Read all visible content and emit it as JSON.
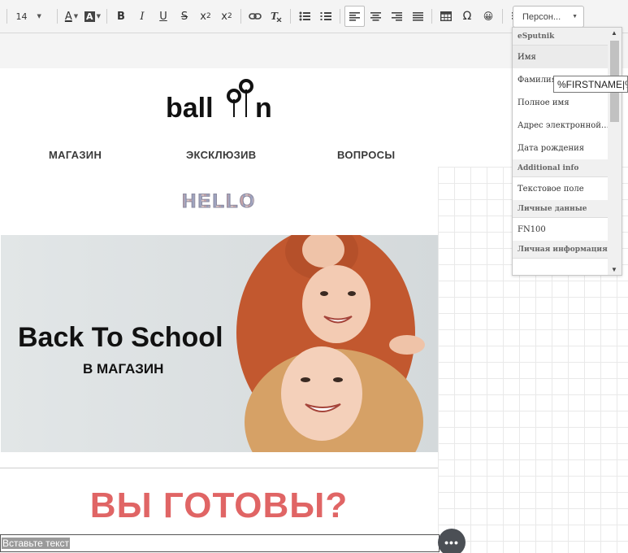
{
  "toolbar": {
    "font_size": "14",
    "persona_label": "Персон...",
    "icons": [
      "font-color-icon",
      "highlight-color-icon",
      "bold-icon",
      "italic-icon",
      "underline-icon",
      "strikethrough-icon",
      "subscript-icon",
      "superscript-icon",
      "link-icon",
      "clear-format-icon",
      "bulleted-list-icon",
      "numbered-list-icon",
      "align-left-icon",
      "align-center-icon",
      "align-right-icon",
      "align-justify-icon",
      "table-icon",
      "special-char-icon",
      "emoji-icon",
      "insert-field-icon"
    ]
  },
  "glyphs": {
    "font_color": "A",
    "highlight": "A",
    "bold": "B",
    "italic": "I",
    "underline": "U",
    "strike": "S",
    "sub_base": "x",
    "sub_idx": "2",
    "sup_base": "x",
    "sup_idx": "2",
    "omega": "Ω",
    "emoji": "😀"
  },
  "email": {
    "logo": "balloon",
    "nav": [
      "МАГАЗИН",
      "ЭКСКЛЮЗИВ",
      "ВОПРОСЫ"
    ],
    "hello": "HELLO",
    "hero_title": "Back To School",
    "hero_subtitle": "В МАГАЗИН",
    "ready": "ВЫ ГОТОВЫ?"
  },
  "insert_bar": {
    "text": "Вставьте текст",
    "more": "•••"
  },
  "dropdown": {
    "groups": [
      {
        "title": "eSputnik",
        "items": [
          "Имя",
          "Фамилия",
          "Полное имя",
          "Адрес электронной почты",
          "Дата рождения"
        ]
      },
      {
        "title": "Additional info",
        "items": [
          "Текстовое поле"
        ]
      },
      {
        "title": "Личные данные",
        "items": [
          "FN100"
        ]
      },
      {
        "title": "Личная информация",
        "items": []
      }
    ],
    "display_items": {
      "email": "Адрес электронной…"
    },
    "selected": "Имя"
  },
  "tooltip": "%FIRSTNAME|%"
}
